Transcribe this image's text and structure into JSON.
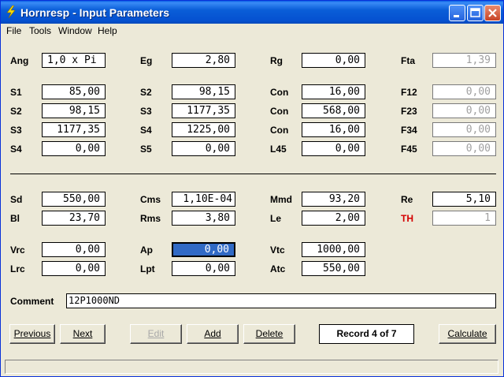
{
  "window": {
    "title": "Hornresp - Input Parameters"
  },
  "menu": {
    "file": "File",
    "tools": "Tools",
    "window": "Window",
    "help": "Help"
  },
  "fields": {
    "ang": {
      "label": "Ang",
      "value": "1,0 x Pi"
    },
    "eg": {
      "label": "Eg",
      "value": "2,80"
    },
    "rg": {
      "label": "Rg",
      "value": "0,00"
    },
    "fta": {
      "label": "Fta",
      "value": "1,39"
    },
    "s1": {
      "label": "S1",
      "value": "85,00"
    },
    "s2a": {
      "label": "S2",
      "value": "98,15"
    },
    "con1": {
      "label": "Con",
      "value": "16,00"
    },
    "f12": {
      "label": "F12",
      "value": "0,00"
    },
    "s2b": {
      "label": "S2",
      "value": "98,15"
    },
    "s3a": {
      "label": "S3",
      "value": "1177,35"
    },
    "con2": {
      "label": "Con",
      "value": "568,00"
    },
    "f23": {
      "label": "F23",
      "value": "0,00"
    },
    "s3b": {
      "label": "S3",
      "value": "1177,35"
    },
    "s4a": {
      "label": "S4",
      "value": "1225,00"
    },
    "con3": {
      "label": "Con",
      "value": "16,00"
    },
    "f34": {
      "label": "F34",
      "value": "0,00"
    },
    "s4b": {
      "label": "S4",
      "value": "0,00"
    },
    "s5": {
      "label": "S5",
      "value": "0,00"
    },
    "l45": {
      "label": "L45",
      "value": "0,00"
    },
    "f45": {
      "label": "F45",
      "value": "0,00"
    },
    "sd": {
      "label": "Sd",
      "value": "550,00"
    },
    "cms": {
      "label": "Cms",
      "value": "1,10E-04"
    },
    "mmd": {
      "label": "Mmd",
      "value": "93,20"
    },
    "re": {
      "label": "Re",
      "value": "5,10"
    },
    "bl": {
      "label": "Bl",
      "value": "23,70"
    },
    "rms": {
      "label": "Rms",
      "value": "3,80"
    },
    "le": {
      "label": "Le",
      "value": "2,00"
    },
    "th": {
      "label": "TH",
      "value": "1"
    },
    "vrc": {
      "label": "Vrc",
      "value": "0,00"
    },
    "ap": {
      "label": "Ap",
      "value": "0,00"
    },
    "vtc": {
      "label": "Vtc",
      "value": "1000,00"
    },
    "lrc": {
      "label": "Lrc",
      "value": "0,00"
    },
    "lpt": {
      "label": "Lpt",
      "value": "0,00"
    },
    "atc": {
      "label": "Atc",
      "value": "550,00"
    }
  },
  "comment": {
    "label": "Comment",
    "value": "12P1000ND"
  },
  "buttons": {
    "previous": "Previous",
    "next": "Next",
    "edit": "Edit",
    "add": "Add",
    "delete": "Delete",
    "calculate": "Calculate"
  },
  "record": "Record 4 of 7",
  "colors": {
    "title_bar": "#0a5ed8",
    "selection": "#316ac5",
    "th_label": "#d40000",
    "disabled_text": "#a0a0a0"
  }
}
